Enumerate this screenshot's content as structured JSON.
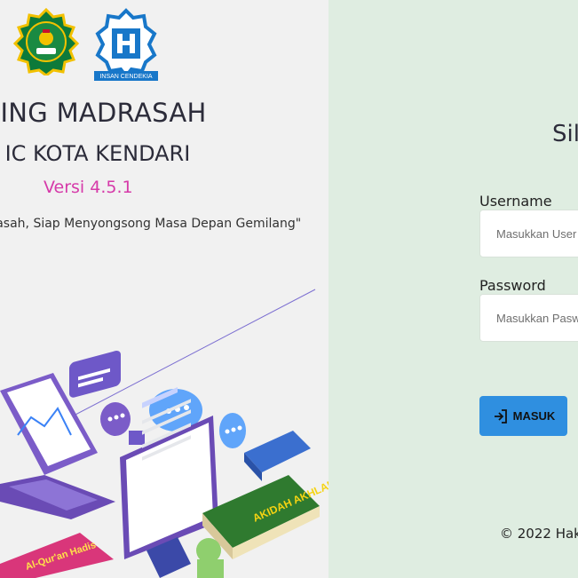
{
  "brand": {
    "logo_left_name": "kemenag-logo",
    "logo_right_text": "INSAN CENDEKIA",
    "title": "RNING MADRASAH",
    "subtitle": "N IC KOTA KENDARI",
    "version": "Versi 4.5.1",
    "tagline": "adrasah, Siap Menyongsong Masa Depan Gemilang\""
  },
  "login": {
    "heading": "Sil",
    "username_label": "Username",
    "username_placeholder": "Masukkan User",
    "password_label": "Password",
    "password_placeholder": "Masukkan Pasw",
    "submit_label": "MASUK"
  },
  "illustration": {
    "book_right_text": "AKIDAH AKHLAK",
    "book_left_text": "Al-Qur'an Hadis"
  },
  "footer": {
    "text": "© 2022 Hak"
  },
  "colors": {
    "left_bg": "#f1f1f1",
    "right_bg": "#dfede1",
    "accent": "#2f8fe0",
    "version": "#d63aa9"
  }
}
